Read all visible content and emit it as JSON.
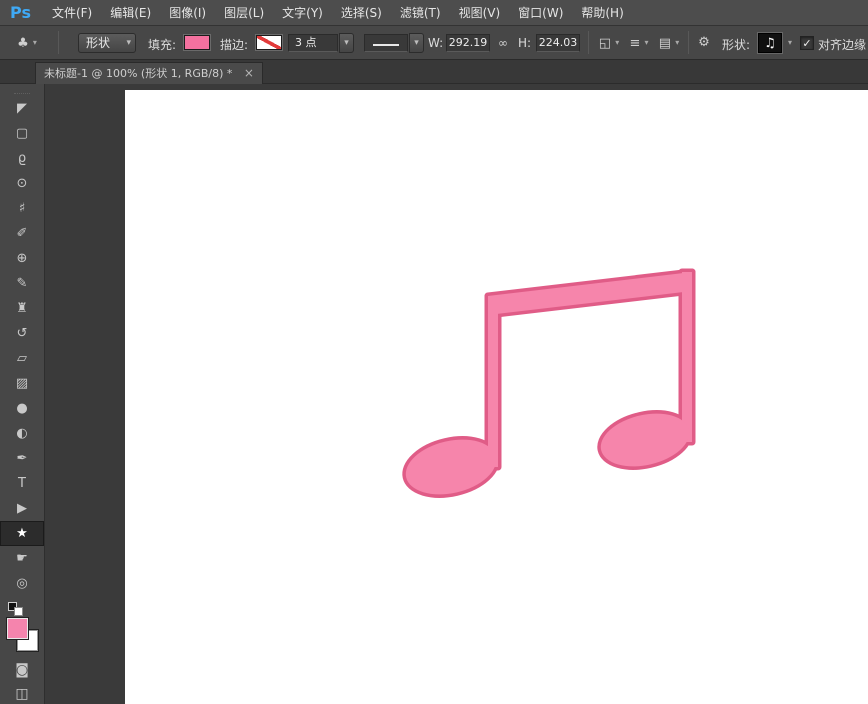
{
  "menu_bar": {
    "logo": "Ps",
    "items": [
      "文件(F)",
      "编辑(E)",
      "图像(I)",
      "图层(L)",
      "文字(Y)",
      "选择(S)",
      "滤镜(T)",
      "视图(V)",
      "窗口(W)",
      "帮助(H)"
    ]
  },
  "options_bar": {
    "tool_preset_icon": "♣",
    "dropdown_arrow": "▾",
    "mode_value": "形状",
    "fill_label": "填充:",
    "fill_color": "#f4719f",
    "stroke_label": "描边:",
    "stroke_width_value": "3 点",
    "w_label": "W:",
    "w_value": "292.19",
    "link_icon": "∞",
    "h_label": "H:",
    "h_value": "224.03",
    "path_ops_icon": "◱",
    "align_icon": "≡",
    "arrange_icon": "▤",
    "gear_icon": "⚙",
    "shape_label": "形状:",
    "shape_thumb_icon": "♫",
    "checkbox_check": "✓",
    "align_edges_label": "对齐边缘"
  },
  "document_tab": {
    "title": "未标题-1 @ 100% (形状 1, RGB/8) *",
    "close_icon": "×"
  },
  "toolbar": {
    "tools": [
      {
        "id": "move",
        "glyph": "◤"
      },
      {
        "id": "rectangular-marquee",
        "glyph": "▢"
      },
      {
        "id": "lasso",
        "glyph": "ϱ"
      },
      {
        "id": "quick-selection",
        "glyph": "⊙"
      },
      {
        "id": "crop",
        "glyph": "♯"
      },
      {
        "id": "eyedropper",
        "glyph": "✐"
      },
      {
        "id": "spot-healing-brush",
        "glyph": "⊕"
      },
      {
        "id": "brush",
        "glyph": "✎"
      },
      {
        "id": "clone-stamp",
        "glyph": "♜"
      },
      {
        "id": "history-brush",
        "glyph": "↺"
      },
      {
        "id": "eraser",
        "glyph": "▱"
      },
      {
        "id": "gradient",
        "glyph": "▨"
      },
      {
        "id": "blur",
        "glyph": "●"
      },
      {
        "id": "dodge",
        "glyph": "◐"
      },
      {
        "id": "pen",
        "glyph": "✒"
      },
      {
        "id": "type",
        "glyph": "T"
      },
      {
        "id": "path-selection",
        "glyph": "▶"
      },
      {
        "id": "custom-shape",
        "glyph": "★",
        "selected": true
      },
      {
        "id": "hand",
        "glyph": "☛"
      },
      {
        "id": "zoom",
        "glyph": "◎"
      }
    ],
    "foreground_color": "#f584ad",
    "background_color": "#ffffff",
    "quick_mask_icon": "◙",
    "screen_mode_icon": "◫"
  },
  "canvas": {
    "shape_fill": "#f685ab",
    "shape_stroke": "#e05c87"
  }
}
